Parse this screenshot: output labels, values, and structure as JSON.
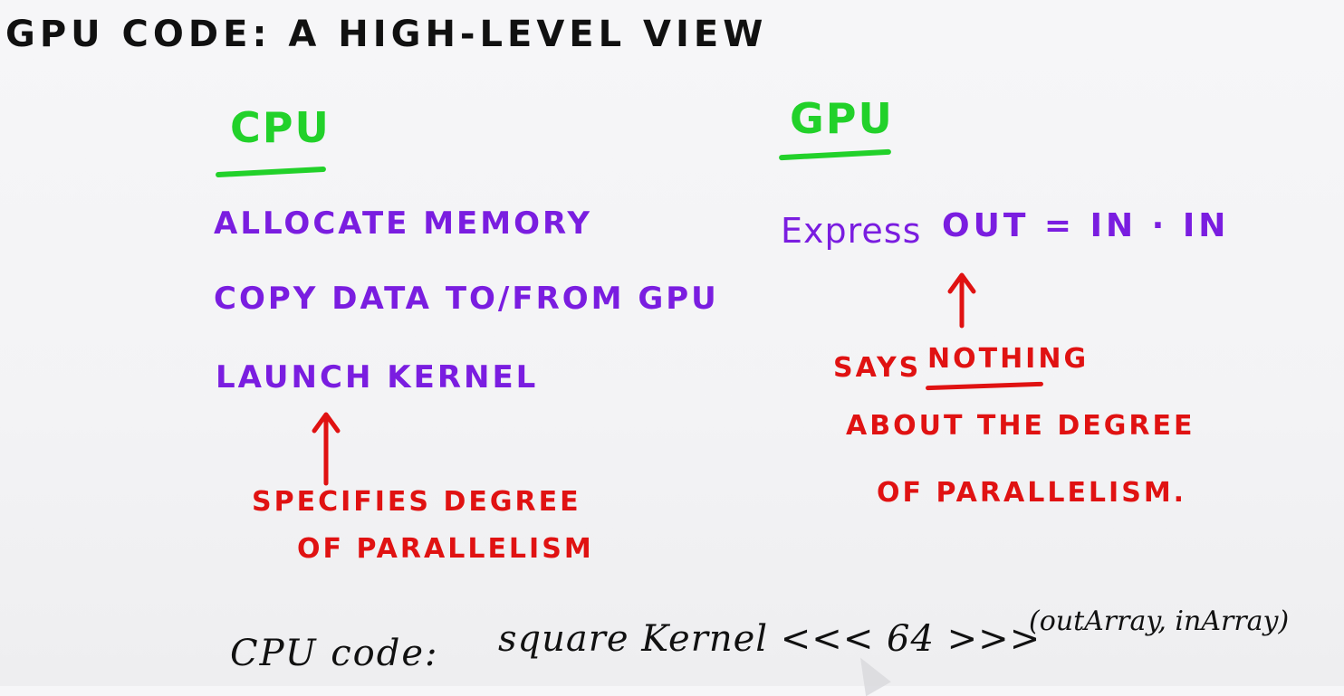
{
  "title": "GPU CODE: A HIGH-LEVEL VIEW",
  "cpu": {
    "heading": "CPU",
    "steps": [
      "ALLOCATE MEMORY",
      "COPY DATA TO/FROM GPU",
      "LAUNCH KERNEL"
    ],
    "note_lines": [
      "SPECIFIES DEGREE",
      "OF PARALLELISM"
    ]
  },
  "gpu": {
    "heading": "GPU",
    "express_label": "Express",
    "equation": "OUT = IN · IN",
    "note_prefix": "SAYS",
    "note_emphasis": "NOTHING",
    "note_lines": [
      "ABOUT THE DEGREE",
      "OF PARALLELISM."
    ]
  },
  "code": {
    "label": "CPU code:",
    "call": "square Kernel <<< 64 >>>",
    "args": "(outArray, inArray)"
  },
  "colors": {
    "heading": "#22d12a",
    "step": "#7a1de0",
    "note": "#e01212",
    "ink": "#111111"
  },
  "icons": {
    "cpu_arrow": "red-up-arrow",
    "gpu_arrow": "red-up-arrow",
    "cursor": "pen-pointer"
  }
}
